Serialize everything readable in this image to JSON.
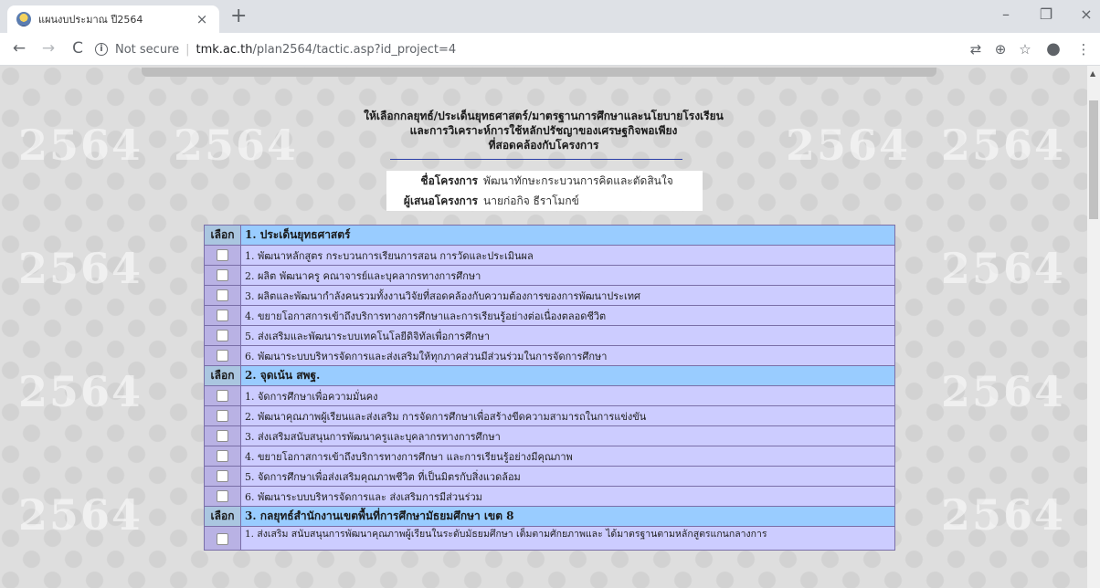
{
  "browser": {
    "tab_title": "แผนงบประมาณ ปี2564",
    "close_glyph": "×",
    "new_tab_glyph": "+",
    "window_controls": {
      "minimize": "–",
      "restore": "❐",
      "close": "×"
    },
    "nav": {
      "back": "←",
      "forward": "→",
      "reload": "C"
    },
    "security_label": "Not secure",
    "url_host": "tmk.ac.th",
    "url_path": "/plan2564/tactic.asp?id_project=4",
    "toolbar_icons": {
      "translate": "⇄",
      "zoom": "⊕",
      "star": "☆",
      "profile": "●",
      "menu": "⋮"
    }
  },
  "page": {
    "watermark_text": "2564",
    "heading_line1": "ให้เลือกกลยุทธ์/ประเด็นยุทธศาสตร์/มาตรฐานการศึกษาและนโยบายโรงเรียน",
    "heading_line2": "และการวิเคราะห์การใช้หลักปรัชญาของเศรษฐกิจพอเพียง",
    "heading_line3": "ที่สอดคล้องกับโครงการ",
    "project": {
      "name_label": "ชื่อโครงการ",
      "name_value": "พัฒนาทักษะกระบวนการคิดและตัดสินใจ",
      "proposer_label": "ผู้เสนอโครงการ",
      "proposer_value": "นายก่อกิจ ธีราโมกข์"
    },
    "select_label": "เลือก",
    "sections": [
      {
        "title": "1. ประเด็นยุทธศาสตร์",
        "items": [
          "1. พัฒนาหลักสูตร กระบวนการเรียนการสอน การวัดและประเมินผล",
          "2. ผลิต พัฒนาครู คณาจารย์และบุคลากรทางการศึกษา",
          "3. ผลิตและพัฒนากำลังคนรวมทั้งงานวิจัยที่สอดคล้องกับความต้องการของการพัฒนาประเทศ",
          "4. ขยายโอกาสการเข้าถึงบริการทางการศึกษาและการเรียนรู้อย่างต่อเนื่องตลอดชีวิต",
          "5. ส่งเสริมและพัฒนาระบบเทคโนโลยีดิจิทัลเพื่อการศึกษา",
          "6. พัฒนาระบบบริหารจัดการและส่งเสริมให้ทุกภาคส่วนมีส่วนร่วมในการจัดการศึกษา"
        ]
      },
      {
        "title": "2. จุดเน้น สพฐ.",
        "items": [
          "1. จัดการศึกษาเพื่อความมั่นคง",
          "2. พัฒนาคุณภาพผู้เรียนและส่งเสริม การจัดการศึกษาเพื่อสร้างขีดความสามารถในการแข่งขัน",
          "3. ส่งเสริมสนับสนุนการพัฒนาครูและบุคลากรทางการศึกษา",
          "4. ขยายโอกาสการเข้าถึงบริการทางการศึกษา และการเรียนรู้อย่างมีคุณภาพ",
          "5. จัดการศึกษาเพื่อส่งเสริมคุณภาพชีวิต ที่เป็นมิตรกับสิ่งแวดล้อม",
          "6. พัฒนาระบบบริหารจัดการและ ส่งเสริมการมีส่วนร่วม"
        ]
      },
      {
        "title": "3. กลยุทธ์สำนักงานเขตพื้นที่การศึกษามัธยมศึกษา เขต 8",
        "items": [
          "1. ส่งเสริม สนับสนุนการพัฒนาคุณภาพผู้เรียนในระดับมัธยมศึกษา เต็มตามศักยภาพและ ได้มาตรฐานตามหลักสูตรแกนกลางการ"
        ]
      }
    ]
  }
}
